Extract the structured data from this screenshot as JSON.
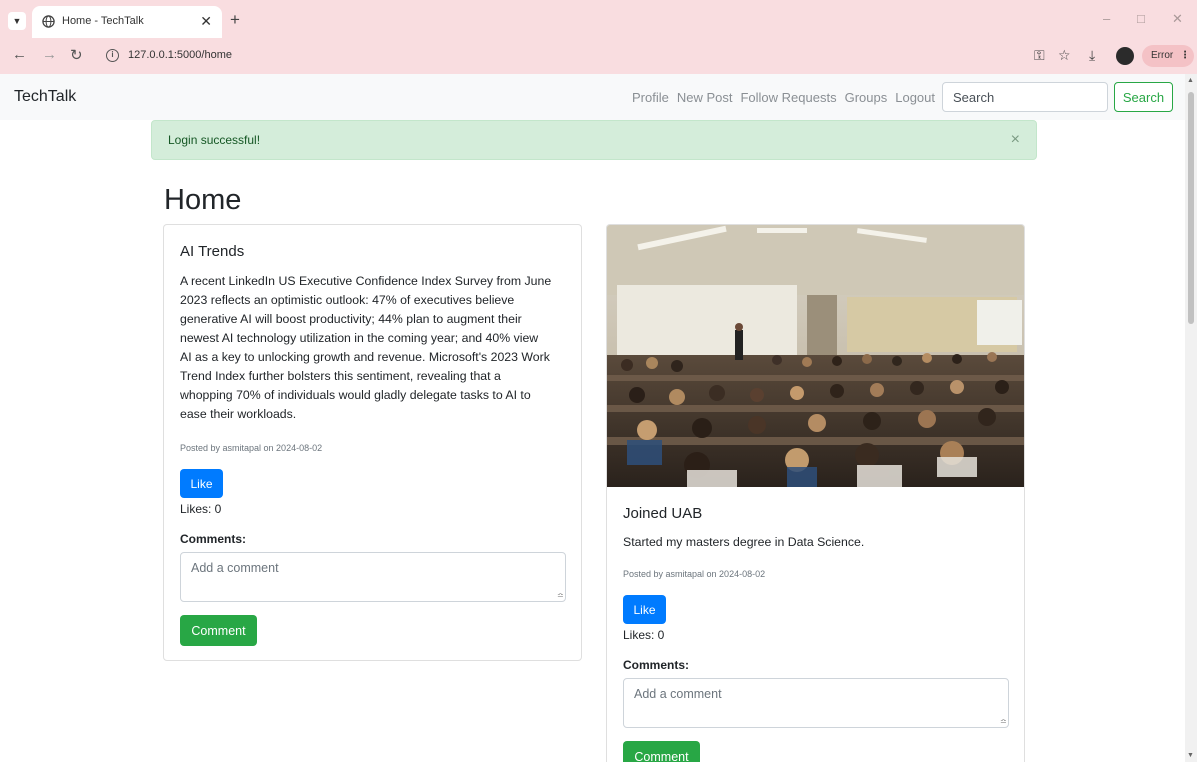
{
  "browser": {
    "tab_title": "Home - TechTalk",
    "url": "127.0.0.1:5000/home",
    "error_label": "Error"
  },
  "navbar": {
    "brand": "TechTalk",
    "links": [
      "Profile",
      "New Post",
      "Follow Requests",
      "Groups",
      "Logout"
    ],
    "search_placeholder": "Search",
    "search_button": "Search"
  },
  "alert": {
    "message": "Login successful!",
    "close": "×"
  },
  "page_title": "Home",
  "posts": [
    {
      "title": "AI Trends",
      "body_lines": [
        "A recent LinkedIn US Executive Confidence Index Survey from June",
        "2023 reflects an optimistic outlook: 47% of executives believe",
        "generative AI will boost productivity; 44% plan to augment their",
        "newest AI technology utilization in the coming year; and 40% view",
        "AI as a key to unlocking growth and revenue. Microsoft's 2023 Work",
        "Trend Index further bolsters this sentiment, revealing that a",
        "whopping 70% of individuals would gladly delegate tasks to AI to",
        "ease their workloads."
      ],
      "meta": "Posted by asmitapal on 2024-08-02",
      "like_label": "Like",
      "likes_text": "Likes: 0",
      "comments_label": "Comments:",
      "comment_placeholder": "Add a comment",
      "comment_button": "Comment"
    },
    {
      "title": "Joined UAB",
      "body": "Started my masters degree in Data Science.",
      "meta": "Posted by asmitapal on 2024-08-02",
      "like_label": "Like",
      "likes_text": "Likes: 0",
      "comments_label": "Comments:",
      "comment_placeholder": "Add a comment",
      "comment_button": "Comment"
    }
  ]
}
